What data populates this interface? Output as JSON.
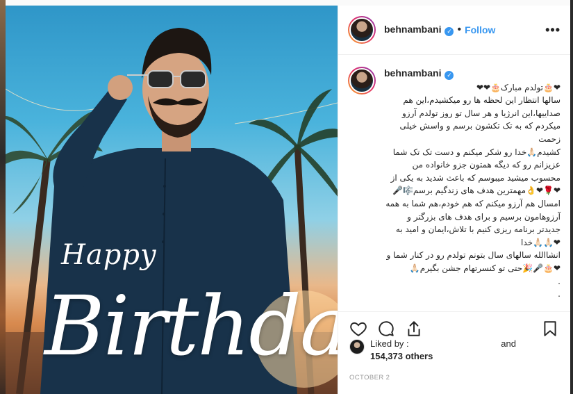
{
  "post": {
    "username": "behnambani",
    "verified_mark": "✓",
    "separator": "•",
    "follow_label": "Follow",
    "more_label": "•••",
    "image_text": {
      "happy": "Happy",
      "birthday": "Birthday"
    }
  },
  "caption": {
    "username": "behnambani",
    "text": "❤🎂تولدم مبارک🎂❤❤\nسالها انتظار این لحظه ها رو میکشیدم،این هم\nصداییها،این انرژیا و هر سال تو روز تولدم آرزو\nمیکردم که به تک تکشون برسم و واسش خیلی زحمت\nکشیدم🙏🏻خدا رو شکر میکنم و دست تک تک شما\nعزیزانم رو که دیگه همتون جزو خانواده من\nمحسوب میشید میبوسم که باعث شدید به یکی از\n❤🌹❤👌مهمترین هدف های زندگیم برسم🎼🎤\nامسال هم آرزو میکنم که هم خودم،هم شما به همه\nآرزوهامون برسیم و برای هدف های بزرگتر و\nجدیدتر برنامه ریزی کنیم با تلاش،ایمان و امید به\n❤🙏🏻🙏🏻خدا\nانشاالله سالهای سال بتونم تولدم رو در کنار شما و\n❤🎂🎤🎉حتی تو کنسرتهام جشن بگیرم🙏🏻\n.\n.\n.\nبه زودي انشاالله دوباره كلي با هم و در كنار هم\nشاد باشيم به اميد اون روزها❤🌹❤🙏🏻"
  },
  "actions": {
    "like_icon": "heart-icon",
    "comment_icon": "comment-icon",
    "share_icon": "share-icon",
    "save_icon": "bookmark-icon"
  },
  "likes": {
    "prefix": "Liked by",
    "colon": ":",
    "and_label": "and",
    "count": "154,373 others"
  },
  "date": "OCTOBER 2",
  "colors": {
    "accent": "#3897f0",
    "text": "#262626",
    "muted": "#999999"
  }
}
